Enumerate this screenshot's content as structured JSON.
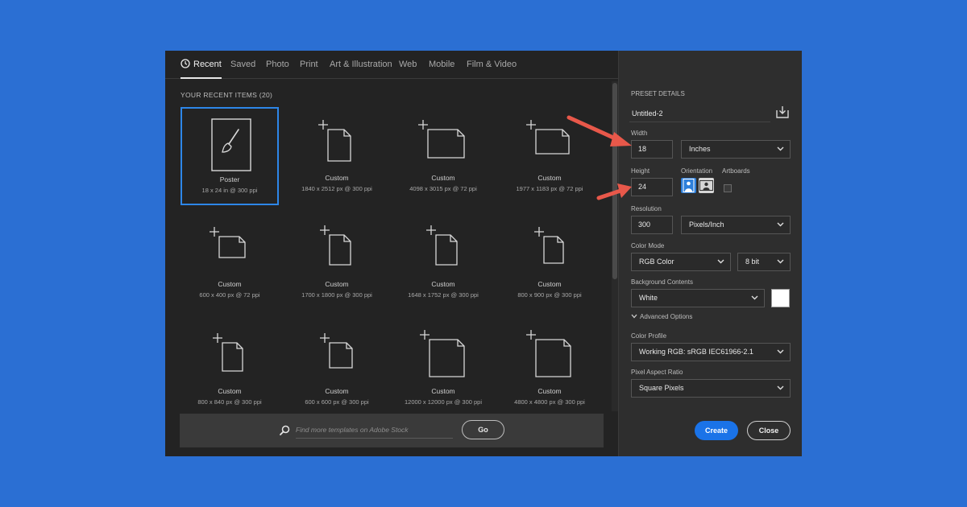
{
  "colors": {
    "background": "#2b6fd3",
    "dialog": "#232323",
    "accent": "#1a73e8",
    "annotation_arrow": "#e8584a"
  },
  "tabs": [
    {
      "label": "Recent",
      "icon": "clock-icon",
      "active": true
    },
    {
      "label": "Saved"
    },
    {
      "label": "Photo"
    },
    {
      "label": "Print"
    },
    {
      "label": "Art & Illustration"
    },
    {
      "label": "Web"
    },
    {
      "label": "Mobile"
    },
    {
      "label": "Film & Video"
    }
  ],
  "recent": {
    "heading": "YOUR RECENT ITEMS  (20)",
    "items": [
      {
        "name": "Poster",
        "size": "18 x 24 in @ 300 ppi",
        "icon": "paintbrush-document-icon",
        "selected": true
      },
      {
        "name": "Custom",
        "size": "1840 x 2512 px @ 300 ppi",
        "icon": "portrait-document-icon"
      },
      {
        "name": "Custom",
        "size": "4098 x 3015 px @ 72 ppi",
        "icon": "landscape-document-icon"
      },
      {
        "name": "Custom",
        "size": "1977 x 1183 px @ 72 ppi",
        "icon": "landscape-document-icon"
      },
      {
        "name": "Custom",
        "size": "600 x 400 px @ 72 ppi",
        "icon": "landscape-document-icon"
      },
      {
        "name": "Custom",
        "size": "1700 x 1800 px @ 300 ppi",
        "icon": "portrait-document-icon"
      },
      {
        "name": "Custom",
        "size": "1648 x 1752 px @ 300 ppi",
        "icon": "portrait-document-icon"
      },
      {
        "name": "Custom",
        "size": "800 x 900 px @ 300 ppi",
        "icon": "portrait-document-icon"
      },
      {
        "name": "Custom",
        "size": "800 x 840 px @ 300 ppi",
        "icon": "portrait-document-icon"
      },
      {
        "name": "Custom",
        "size": "600 x 600 px @ 300 ppi",
        "icon": "square-document-icon"
      },
      {
        "name": "Custom",
        "size": "12000 x 12000 px @ 300 ppi",
        "icon": "square-document-icon"
      },
      {
        "name": "Custom",
        "size": "4800 x 4800 px @ 300 ppi",
        "icon": "square-document-icon"
      }
    ]
  },
  "search": {
    "placeholder": "Find more templates on Adobe Stock",
    "value": "",
    "go_label": "Go"
  },
  "preset": {
    "heading": "PRESET DETAILS",
    "name": "Untitled-2",
    "save_icon": "save-preset-icon",
    "width_label": "Width",
    "width_value": "18",
    "width_unit": "Inches",
    "height_label": "Height",
    "height_value": "24",
    "orientation_label": "Orientation",
    "orientation_selected": "portrait",
    "artboards_label": "Artboards",
    "artboards_checked": false,
    "resolution_label": "Resolution",
    "resolution_value": "300",
    "resolution_unit": "Pixels/Inch",
    "color_mode_label": "Color Mode",
    "color_mode": "RGB Color",
    "bit_depth": "8 bit",
    "background_label": "Background Contents",
    "background": "White",
    "background_swatch": "#ffffff",
    "advanced_label": "Advanced Options",
    "color_profile_label": "Color Profile",
    "color_profile": "Working RGB: sRGB IEC61966-2.1",
    "pixel_aspect_label": "Pixel Aspect Ratio",
    "pixel_aspect": "Square Pixels"
  },
  "actions": {
    "create_label": "Create",
    "close_label": "Close"
  }
}
